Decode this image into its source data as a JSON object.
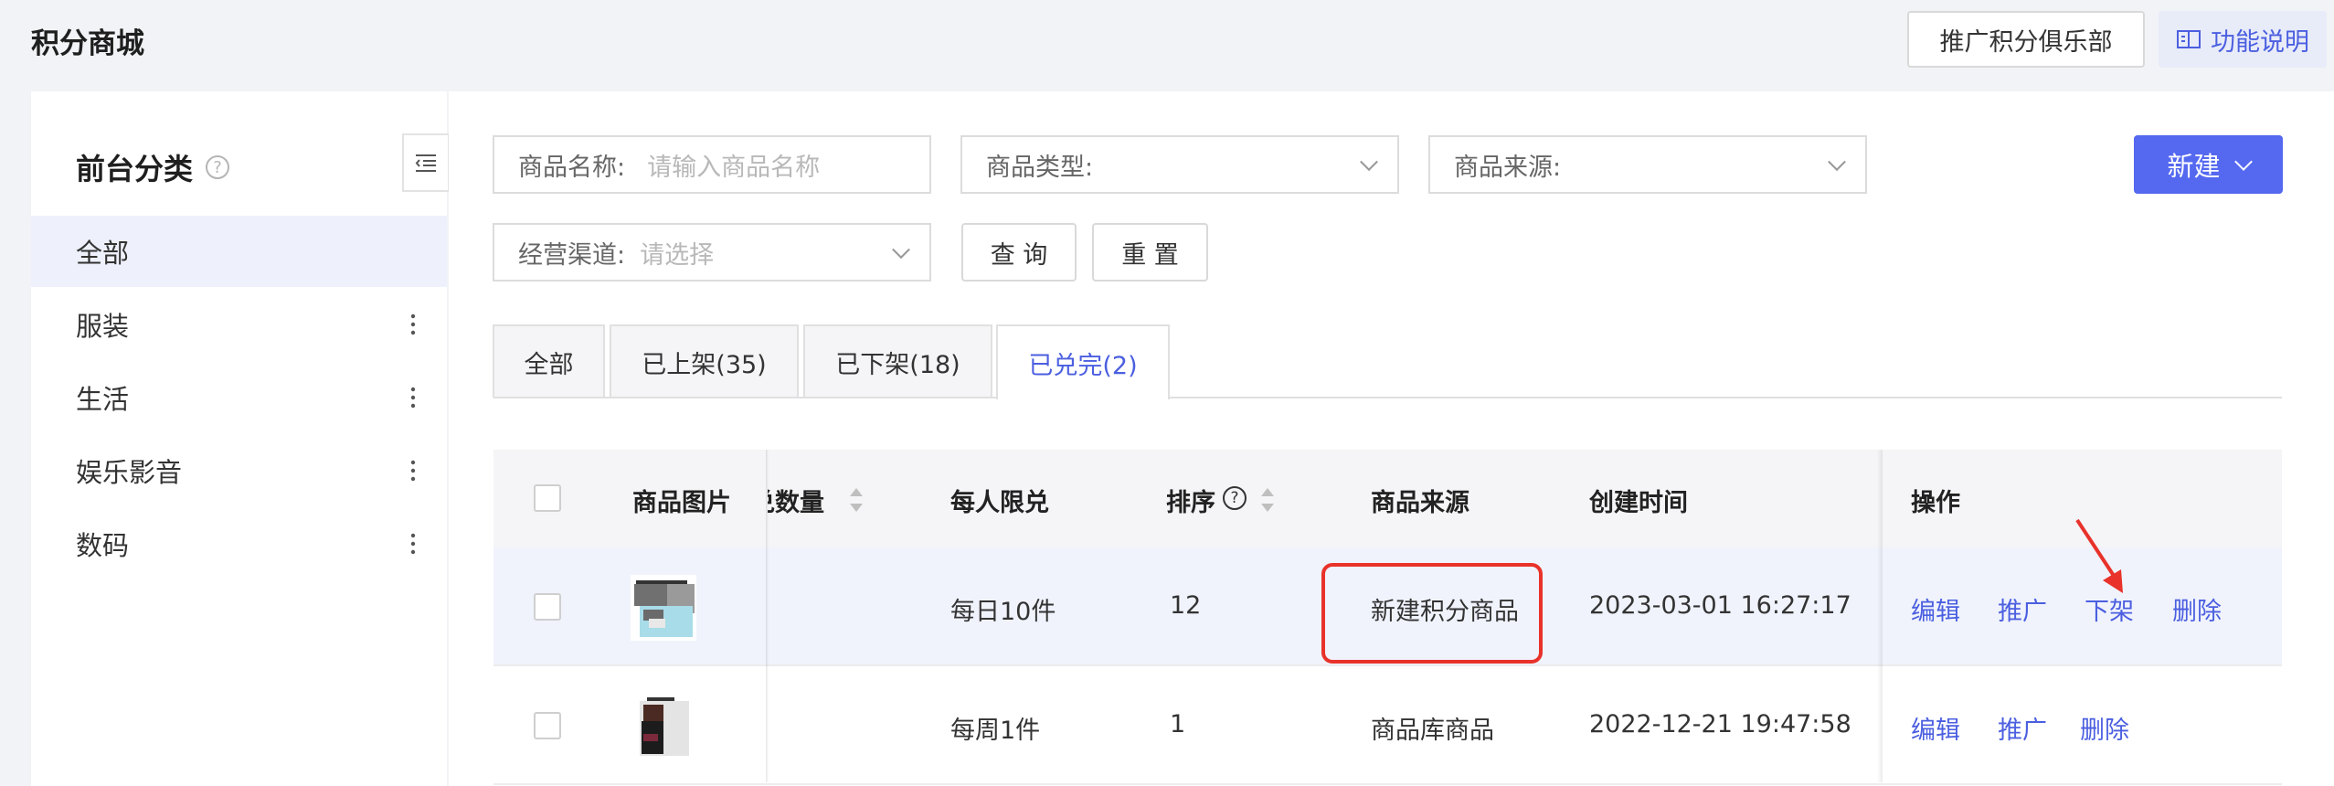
{
  "header": {
    "title": "积分商城",
    "club_button": "推广积分俱乐部",
    "doc_button": "功能说明"
  },
  "sidebar": {
    "title": "前台分类",
    "items": [
      {
        "label": "全部"
      },
      {
        "label": "服装"
      },
      {
        "label": "生活"
      },
      {
        "label": "娱乐影音"
      },
      {
        "label": "数码"
      }
    ]
  },
  "filters": {
    "name_label": "商品名称:",
    "name_placeholder": "请输入商品名称",
    "type_label": "商品类型:",
    "source_label": "商品来源:",
    "channel_label": "经营渠道:",
    "channel_placeholder": "请选择",
    "query_button": "查 询",
    "reset_button": "重 置",
    "new_button": "新建"
  },
  "tabs": [
    {
      "label": "全部"
    },
    {
      "label": "已上架(35)"
    },
    {
      "label": "已下架(18)"
    },
    {
      "label": "已兑完(2)"
    }
  ],
  "table": {
    "columns": {
      "image": "商品图片",
      "redeemed": "兑数量",
      "limit": "每人限兑",
      "sort": "排序",
      "source": "商品来源",
      "created": "创建时间",
      "actions": "操作"
    },
    "rows": [
      {
        "limit": "每日10件",
        "sort": "12",
        "source": "新建积分商品",
        "created": "2023-03-01 16:27:17",
        "actions": [
          "编辑",
          "推广",
          "下架",
          "删除"
        ]
      },
      {
        "limit": "每周1件",
        "sort": "1",
        "source": "商品库商品",
        "created": "2022-12-21 19:47:58",
        "actions": [
          "编辑",
          "推广",
          "删除"
        ]
      }
    ]
  },
  "colors": {
    "accent": "#5468f0",
    "link": "#4b5fe0",
    "highlight": "#e8322a"
  }
}
